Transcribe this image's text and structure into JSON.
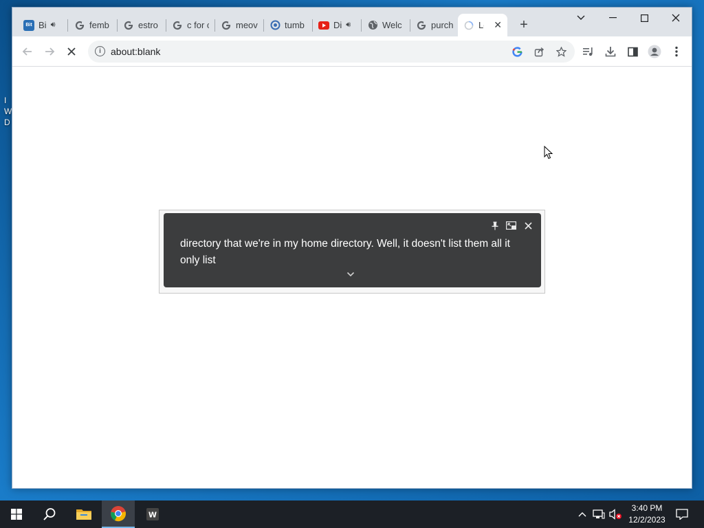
{
  "desktop": {
    "peek_lines": [
      "I",
      "W",
      "D"
    ]
  },
  "browser": {
    "tabs": [
      {
        "favicon": "bitview-icon",
        "title": "Bi",
        "audio": true
      },
      {
        "favicon": "google-icon",
        "title": "femb",
        "audio": false
      },
      {
        "favicon": "google-icon",
        "title": "estro",
        "audio": false
      },
      {
        "favicon": "google-icon",
        "title": "c for c",
        "audio": false
      },
      {
        "favicon": "google-icon",
        "title": "meov",
        "audio": false
      },
      {
        "favicon": "tumblr-icon",
        "title": "tumb",
        "audio": false
      },
      {
        "favicon": "youtube-icon",
        "title": "Di",
        "audio": true
      },
      {
        "favicon": "globe-icon",
        "title": "Welc",
        "audio": false
      },
      {
        "favicon": "google-icon",
        "title": "purch",
        "audio": false
      },
      {
        "favicon": "loading-icon",
        "title": "Lo",
        "audio": false,
        "active": true
      }
    ],
    "url": "about:blank"
  },
  "caption": {
    "text": "directory that we're in my home directory. Well, it doesn't list them all it only list"
  },
  "taskbar": {
    "time": "3:40 PM",
    "date": "12/2/2023"
  },
  "colors": {
    "taskbar_bg": "#1c2026",
    "caption_bg": "#3c3d3e",
    "tabstrip_bg": "#dfe3e8",
    "accent": "#76b9ed"
  }
}
